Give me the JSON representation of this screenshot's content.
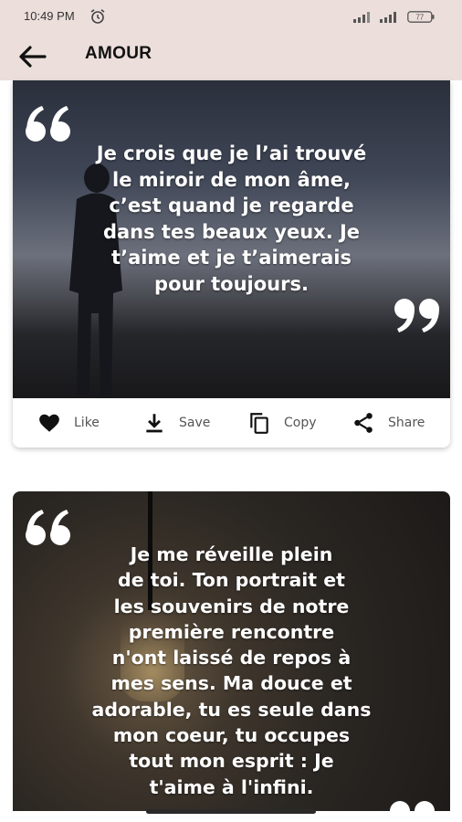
{
  "status_bar": {
    "time": "10:49 PM",
    "battery": "77"
  },
  "app_bar": {
    "title": "AMOUR",
    "back_icon": "arrow-left-icon"
  },
  "quotes": [
    {
      "text": "Je crois que je l’ai trouvé le miroir de mon âme, c’est quand je regarde dans tes beaux yeux. Je t’aime et je t’aimerais pour toujours.",
      "lines": [
        "Je crois que je l’ai trouvé",
        "le miroir de mon âme,",
        "c’est quand je regarde",
        "dans tes beaux yeux. Je",
        "t’aime et je t’aimerais",
        "pour toujours."
      ]
    },
    {
      "text": "Je me réveille plein de toi. Ton portrait et les souvenirs de notre première rencontre n'ont laissé de repos à mes sens. Ma douce et adorable, tu es seule dans mon coeur, tu occupes tout mon esprit : Je t'aime à l'infini.",
      "lines": [
        "Je me réveille plein",
        "de toi. Ton portrait et",
        "les souvenirs de notre",
        "première rencontre",
        "n'ont laissé de repos à",
        "mes sens. Ma douce et",
        "adorable, tu es seule dans",
        "mon coeur, tu occupes",
        "tout mon esprit : Je",
        "t'aime à l'infini."
      ]
    }
  ],
  "actions": {
    "like": "Like",
    "save": "Save",
    "copy": "Copy",
    "share": "Share"
  },
  "colors": {
    "app_bar_bg": "#ebdedb",
    "quote_text": "#ffffff",
    "action_text": "#555555"
  }
}
